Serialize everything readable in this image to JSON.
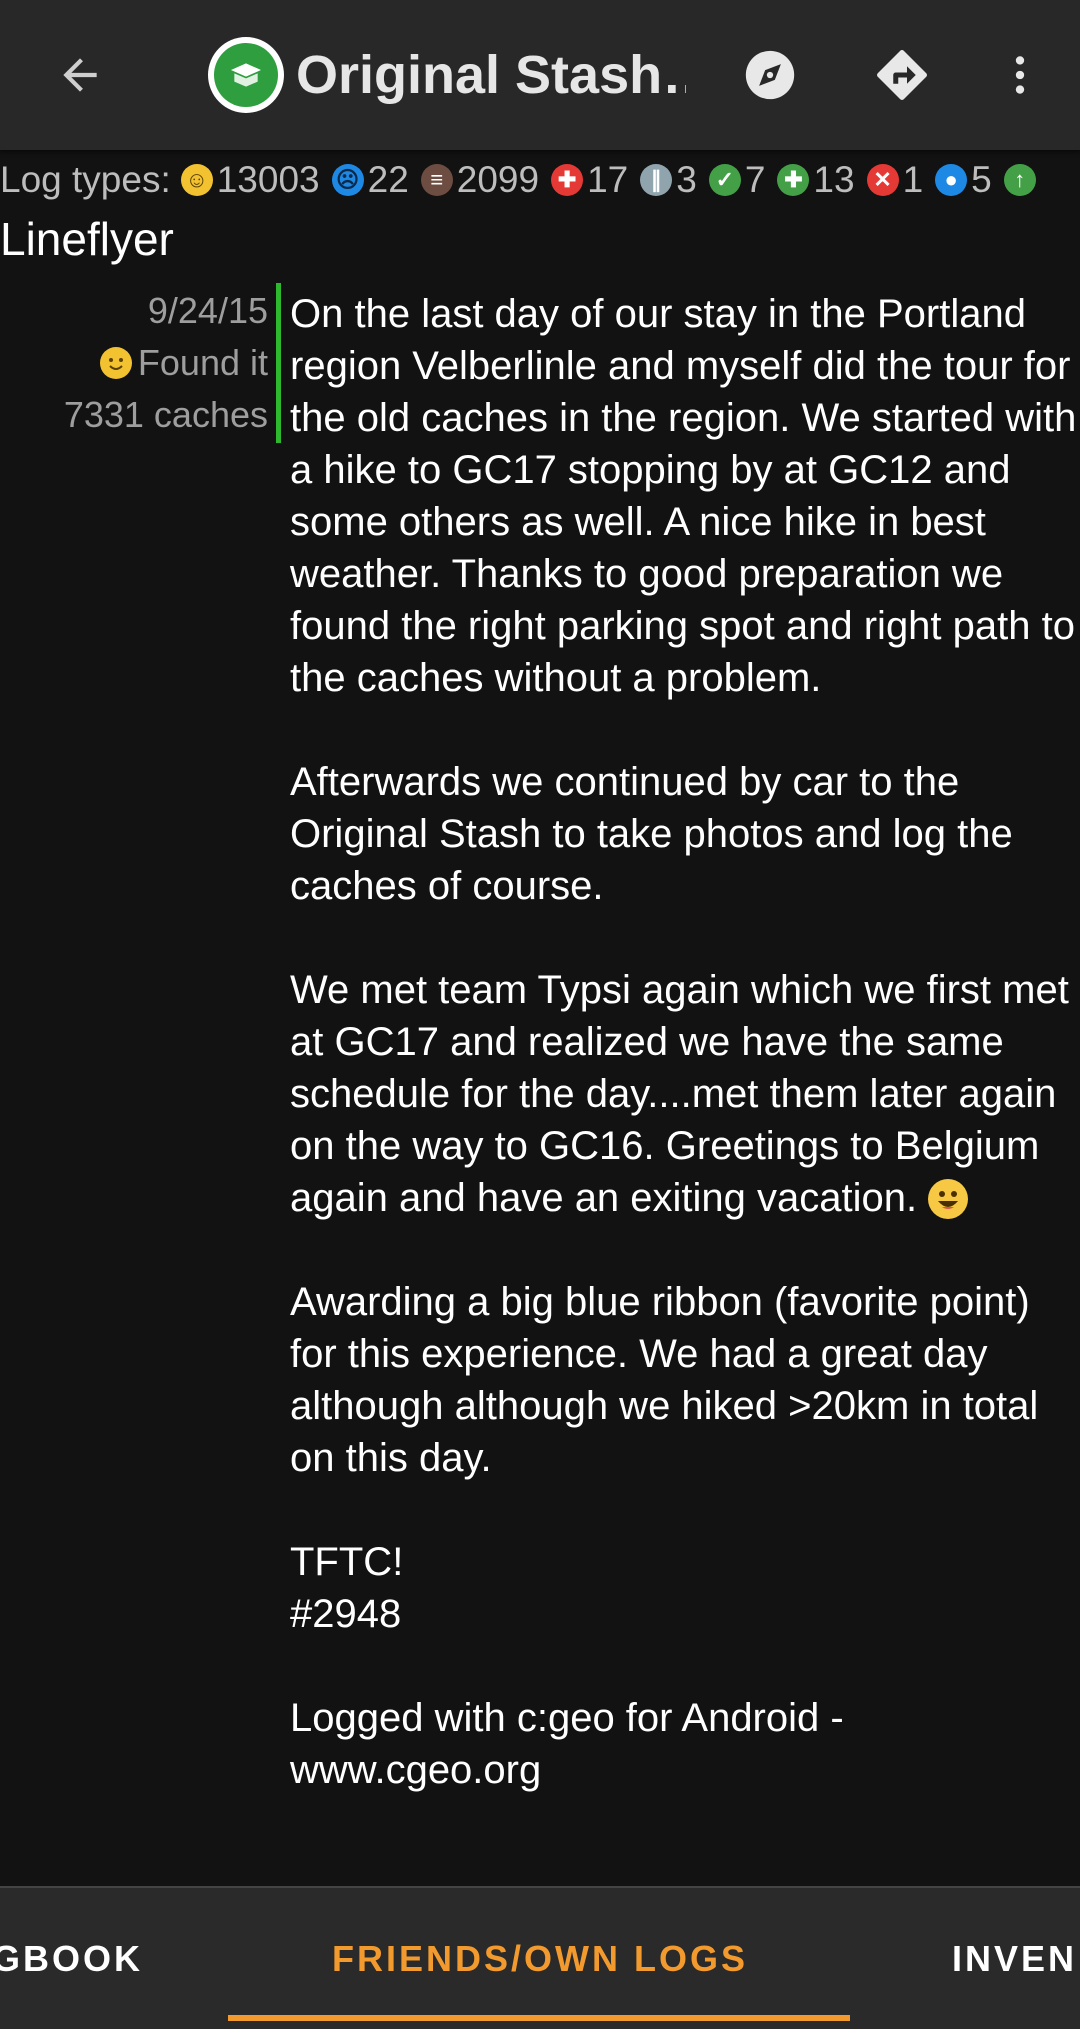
{
  "appbar": {
    "title": "Original Stash…",
    "back_icon": "arrow-back-icon",
    "logo_icon": "cache-type-traditional-icon",
    "compass_icon": "compass-icon",
    "navigate_icon": "navigate-directions-icon",
    "more_icon": "more-vert-icon"
  },
  "log_types": {
    "label": "Log types:",
    "items": [
      {
        "icon": "found-it-icon",
        "color": "#f2c230",
        "count": "13003"
      },
      {
        "icon": "didnt-find-icon",
        "color": "#1e88e5",
        "count": "22"
      },
      {
        "icon": "note-icon",
        "color": "#6d4c41",
        "count": "2099"
      },
      {
        "icon": "needs-maintenance-icon",
        "color": "#e53935",
        "count": "17"
      },
      {
        "icon": "disabled-icon",
        "color": "#90a4ae",
        "count": "3"
      },
      {
        "icon": "enabled-icon",
        "color": "#43a047",
        "count": "7"
      },
      {
        "icon": "maintenance-performed-icon",
        "color": "#43a047",
        "count": "13"
      },
      {
        "icon": "archived-icon",
        "color": "#e53935",
        "count": "1"
      },
      {
        "icon": "reviewer-note-icon",
        "color": "#1e88e5",
        "count": "5"
      },
      {
        "icon": "published-icon",
        "color": "#43a047",
        "count": ""
      }
    ]
  },
  "log": {
    "author": "Lineflyer",
    "date": "9/24/15",
    "type": "Found it",
    "finds": "7331 caches",
    "para1": "On the last day of our stay in the Portland region Velberlinle and myself did the tour for the old caches in the region. We started with a hike to GC17 stopping by at GC12 and some others as well. A nice hike in best weather. Thanks to good preparation we found the right parking spot and right path to the caches without a problem.",
    "para2": "Afterwards we continued by car to the Original Stash to take photos and log the caches of course.",
    "para3": "We met team Typsi again which we first met at GC17 and realized we have the same schedule for the day....met them later again on the way to GC16. Greetings to Belgium again and have an exiting vacation.",
    "para4": "Awarding a big blue ribbon (favorite point) for this experience. We had a great day although although we hiked >20km in total on this day.",
    "para5": "TFTC!\n#2948",
    "para6": "Logged with c:geo for Android - www.cgeo.org"
  },
  "tabs": {
    "left": "GBOOK",
    "active": "FRIENDS/OWN LOGS",
    "right": "INVEN"
  }
}
